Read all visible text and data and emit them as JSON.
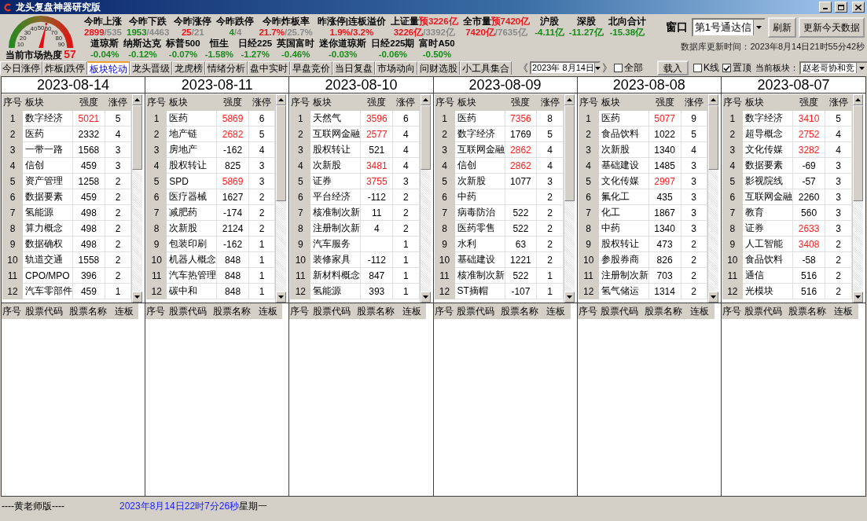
{
  "window": {
    "title": "龙头复盘神器研究版"
  },
  "gauge": {
    "ticks": [
      "10",
      "20",
      "30",
      "40",
      "50",
      "60",
      "70",
      "80",
      "90"
    ],
    "level": 0.57,
    "label": "当前市场热度",
    "value": "57"
  },
  "stats": [
    {
      "label": "今昨上涨",
      "parts": [
        {
          "text": "2899",
          "color": "#e8161b"
        },
        {
          "text": "/535",
          "color": "#8a8a8a"
        }
      ]
    },
    {
      "label": "今昨下跌",
      "parts": [
        {
          "text": "1953",
          "color": "#1a8a1a"
        },
        {
          "text": "/4463",
          "color": "#8a8a8a"
        }
      ]
    },
    {
      "label": "今昨涨停",
      "parts": [
        {
          "text": "25",
          "color": "#e8161b"
        },
        {
          "text": "/21",
          "color": "#8a8a8a"
        }
      ]
    },
    {
      "label": "今昨跌停",
      "parts": [
        {
          "text": "4",
          "color": "#1a8a1a"
        },
        {
          "text": "/4",
          "color": "#8a8a8a"
        }
      ]
    },
    {
      "label": "今昨炸板率",
      "parts": [
        {
          "text": "21.7%",
          "color": "#e8161b"
        },
        {
          "text": "/25.7%",
          "color": "#8a8a8a"
        }
      ]
    },
    {
      "label": "昨涨停|连板溢价",
      "parts": [
        {
          "text": "1.9%",
          "color": "#e8161b"
        },
        {
          "text": "/3.2%",
          "color": "#e8161b"
        }
      ]
    },
    {
      "label": "上证量",
      "forecast": "预3226亿",
      "parts": [
        {
          "text": "3226亿",
          "color": "#e8161b"
        },
        {
          "text": "/3392亿",
          "color": "#8a8a8a"
        }
      ]
    },
    {
      "label": "全市量",
      "forecast": "预7420亿",
      "parts": [
        {
          "text": "7420亿",
          "color": "#e8161b"
        },
        {
          "text": "/7635亿",
          "color": "#8a8a8a"
        }
      ]
    },
    {
      "label": "沪股",
      "parts": [
        {
          "text": "-4.11亿",
          "color": "#1a8a1a"
        }
      ]
    },
    {
      "label": "深股",
      "parts": [
        {
          "text": "-11.27亿",
          "color": "#1a8a1a"
        }
      ]
    },
    {
      "label": "北向合计",
      "parts": [
        {
          "text": "-15.38亿",
          "color": "#1a8a1a"
        }
      ]
    }
  ],
  "indices": [
    {
      "label": "道琼斯",
      "value": "-0.04%",
      "color": "#1a8a1a"
    },
    {
      "label": "纳斯达克",
      "value": "-0.12%",
      "color": "#1a8a1a"
    },
    {
      "label": "标普500",
      "value": "-0.07%",
      "color": "#1a8a1a"
    },
    {
      "label": "恒生",
      "value": "-1.58%",
      "color": "#1a8a1a"
    },
    {
      "label": "日经225",
      "value": "-1.27%",
      "color": "#1a8a1a"
    },
    {
      "label": "英国富时",
      "value": "-0.46%",
      "color": "#1a8a1a"
    },
    {
      "label": "迷你道琼斯",
      "value": "-0.03%",
      "color": "#1a8a1a"
    },
    {
      "label": "日经225期",
      "value": "-0.06%",
      "color": "#1a8a1a"
    },
    {
      "label": "富时A50",
      "value": "-0.50%",
      "color": "#1a8a1a"
    }
  ],
  "window_picker": {
    "label": "窗口",
    "value": "第1号通达信"
  },
  "buttons": [
    "刷新",
    "更新今天数据"
  ],
  "db_update": "数据库更新时间：2023年8月14日21时55分42秒",
  "tabs": [
    {
      "label": "今日涨停",
      "selected": false
    },
    {
      "label": "炸板|跌停",
      "selected": false
    },
    {
      "label": "板块轮动",
      "selected": true
    },
    {
      "label": "龙头晋级",
      "selected": false
    },
    {
      "label": "龙虎榜",
      "selected": false
    },
    {
      "label": "情绪分析",
      "selected": false
    },
    {
      "label": "盘中实时",
      "selected": false
    },
    {
      "label": "早盘竞价",
      "selected": false
    },
    {
      "label": "当日复盘",
      "selected": false
    },
    {
      "label": "市场动向",
      "selected": false
    },
    {
      "label": "问财选股",
      "selected": false
    },
    {
      "label": "小工具集合",
      "selected": false
    }
  ],
  "date_nav": {
    "prev": "《",
    "date": "2023年 8月14日",
    "next": "》",
    "all": {
      "label": "全部",
      "checked": false
    }
  },
  "load_button": "载入",
  "options": [
    {
      "label": "K线",
      "checked": false
    },
    {
      "label": "置顶",
      "checked": true
    }
  ],
  "current_sector": {
    "label": "当前板块：",
    "value": "赵老哥协和竞"
  },
  "days": [
    {
      "date": "2023-08-14",
      "columns": [
        "序号",
        "板块",
        "强度",
        "涨停"
      ],
      "stock_columns": [
        "序号",
        "股票代码",
        "股票名称",
        "连板"
      ],
      "rows": [
        {
          "no": "1",
          "sector": "数字经济",
          "strength": "5021",
          "hot": true,
          "limit_ups": "5"
        },
        {
          "no": "2",
          "sector": "医药",
          "strength": "2332",
          "hot": false,
          "limit_ups": "4"
        },
        {
          "no": "3",
          "sector": "一带一路",
          "strength": "1568",
          "hot": false,
          "limit_ups": "3"
        },
        {
          "no": "4",
          "sector": "信创",
          "strength": "459",
          "hot": false,
          "limit_ups": "3"
        },
        {
          "no": "5",
          "sector": "资产管理",
          "strength": "1258",
          "hot": false,
          "limit_ups": "2"
        },
        {
          "no": "6",
          "sector": "数据要素",
          "strength": "459",
          "hot": false,
          "limit_ups": "2"
        },
        {
          "no": "7",
          "sector": "氢能源",
          "strength": "498",
          "hot": false,
          "limit_ups": "2"
        },
        {
          "no": "8",
          "sector": "算力概念",
          "strength": "498",
          "hot": false,
          "limit_ups": "2"
        },
        {
          "no": "9",
          "sector": "数据确权",
          "strength": "498",
          "hot": false,
          "limit_ups": "2"
        },
        {
          "no": "10",
          "sector": "轨道交通",
          "strength": "1558",
          "hot": false,
          "limit_ups": "2"
        },
        {
          "no": "11",
          "sector": "CPO/MPO",
          "strength": "396",
          "hot": false,
          "limit_ups": "2"
        },
        {
          "no": "12",
          "sector": "汽车零部件",
          "strength": "459",
          "hot": false,
          "limit_ups": "1"
        }
      ]
    },
    {
      "date": "2023-08-11",
      "columns": [
        "序号",
        "板块",
        "强度",
        "涨停"
      ],
      "stock_columns": [
        "序号",
        "股票代码",
        "股票名称",
        "连板"
      ],
      "rows": [
        {
          "no": "1",
          "sector": "医药",
          "strength": "5869",
          "hot": true,
          "limit_ups": "6"
        },
        {
          "no": "2",
          "sector": "地产链",
          "strength": "2682",
          "hot": true,
          "limit_ups": "5"
        },
        {
          "no": "3",
          "sector": "房地产",
          "strength": "-162",
          "hot": false,
          "limit_ups": "4"
        },
        {
          "no": "4",
          "sector": "股权转让",
          "strength": "825",
          "hot": false,
          "limit_ups": "3"
        },
        {
          "no": "5",
          "sector": "SPD",
          "strength": "5869",
          "hot": true,
          "limit_ups": "3"
        },
        {
          "no": "6",
          "sector": "医疗器械",
          "strength": "1627",
          "hot": false,
          "limit_ups": "2"
        },
        {
          "no": "7",
          "sector": "减肥药",
          "strength": "-174",
          "hot": false,
          "limit_ups": "2"
        },
        {
          "no": "8",
          "sector": "次新股",
          "strength": "2124",
          "hot": false,
          "limit_ups": "2"
        },
        {
          "no": "9",
          "sector": "包装印刷",
          "strength": "-162",
          "hot": false,
          "limit_ups": "1"
        },
        {
          "no": "10",
          "sector": "机器人概念",
          "strength": "848",
          "hot": false,
          "limit_ups": "1"
        },
        {
          "no": "11",
          "sector": "汽车热管理",
          "strength": "848",
          "hot": false,
          "limit_ups": "1"
        },
        {
          "no": "12",
          "sector": "碳中和",
          "strength": "848",
          "hot": false,
          "limit_ups": "1"
        }
      ]
    },
    {
      "date": "2023-08-10",
      "columns": [
        "序号",
        "板块",
        "强度",
        "涨停"
      ],
      "stock_columns": [
        "序号",
        "股票代码",
        "股票名称",
        "连板"
      ],
      "rows": [
        {
          "no": "1",
          "sector": "天然气",
          "strength": "3596",
          "hot": true,
          "limit_ups": "6"
        },
        {
          "no": "2",
          "sector": "互联网金融",
          "strength": "2577",
          "hot": true,
          "limit_ups": "4"
        },
        {
          "no": "3",
          "sector": "股权转让",
          "strength": "521",
          "hot": false,
          "limit_ups": "4"
        },
        {
          "no": "4",
          "sector": "次新股",
          "strength": "3481",
          "hot": true,
          "limit_ups": "4"
        },
        {
          "no": "5",
          "sector": "证券",
          "strength": "3755",
          "hot": true,
          "limit_ups": "3"
        },
        {
          "no": "6",
          "sector": "平台经济",
          "strength": "-112",
          "hot": false,
          "limit_ups": "2"
        },
        {
          "no": "7",
          "sector": "核准制次新",
          "strength": "11",
          "hot": false,
          "limit_ups": "2"
        },
        {
          "no": "8",
          "sector": "注册制次新",
          "strength": "4",
          "hot": false,
          "limit_ups": "2"
        },
        {
          "no": "9",
          "sector": "汽车服务",
          "limit_ups": "1"
        },
        {
          "no": "10",
          "sector": "装修家具",
          "strength": "-112",
          "hot": false,
          "limit_ups": "1"
        },
        {
          "no": "11",
          "sector": "新材料概念",
          "strength": "847",
          "hot": false,
          "limit_ups": "1"
        },
        {
          "no": "12",
          "sector": "氢能源",
          "strength": "393",
          "hot": false,
          "limit_ups": "1"
        }
      ]
    },
    {
      "date": "2023-08-09",
      "columns": [
        "序号",
        "板块",
        "强度",
        "涨停"
      ],
      "stock_columns": [
        "序号",
        "股票代码",
        "股票名称",
        "连板"
      ],
      "rows": [
        {
          "no": "1",
          "sector": "医药",
          "strength": "7356",
          "hot": true,
          "limit_ups": "8"
        },
        {
          "no": "2",
          "sector": "数字经济",
          "strength": "1769",
          "hot": false,
          "limit_ups": "5"
        },
        {
          "no": "3",
          "sector": "互联网金融",
          "strength": "2862",
          "hot": true,
          "limit_ups": "4"
        },
        {
          "no": "4",
          "sector": "信创",
          "strength": "2862",
          "hot": true,
          "limit_ups": "4"
        },
        {
          "no": "5",
          "sector": "次新股",
          "strength": "1077",
          "hot": false,
          "limit_ups": "3"
        },
        {
          "no": "6",
          "sector": "中药",
          "limit_ups": "2"
        },
        {
          "no": "7",
          "sector": "病毒防治",
          "strength": "522",
          "hot": false,
          "limit_ups": "2"
        },
        {
          "no": "8",
          "sector": "医药零售",
          "strength": "522",
          "hot": false,
          "limit_ups": "2"
        },
        {
          "no": "9",
          "sector": "水利",
          "strength": "63",
          "hot": false,
          "limit_ups": "2"
        },
        {
          "no": "10",
          "sector": "基础建设",
          "strength": "1221",
          "hot": false,
          "limit_ups": "2"
        },
        {
          "no": "11",
          "sector": "核准制次新",
          "strength": "522",
          "hot": false,
          "limit_ups": "1"
        },
        {
          "no": "12",
          "sector": "ST摘帽",
          "strength": "-107",
          "hot": false,
          "limit_ups": "1"
        }
      ]
    },
    {
      "date": "2023-08-08",
      "columns": [
        "序号",
        "板块",
        "强度",
        "涨停"
      ],
      "stock_columns": [
        "序号",
        "股票代码",
        "股票名称",
        "连板"
      ],
      "rows": [
        {
          "no": "1",
          "sector": "医药",
          "strength": "5077",
          "hot": true,
          "limit_ups": "9"
        },
        {
          "no": "2",
          "sector": "食品饮料",
          "strength": "1022",
          "hot": false,
          "limit_ups": "5"
        },
        {
          "no": "3",
          "sector": "次新股",
          "strength": "1340",
          "hot": false,
          "limit_ups": "4"
        },
        {
          "no": "4",
          "sector": "基础建设",
          "strength": "1485",
          "hot": false,
          "limit_ups": "3"
        },
        {
          "no": "5",
          "sector": "文化传媒",
          "strength": "2997",
          "hot": true,
          "limit_ups": "3"
        },
        {
          "no": "6",
          "sector": "氟化工",
          "strength": "435",
          "hot": false,
          "limit_ups": "3"
        },
        {
          "no": "7",
          "sector": "化工",
          "strength": "1867",
          "hot": false,
          "limit_ups": "3"
        },
        {
          "no": "8",
          "sector": "中药",
          "strength": "1340",
          "hot": false,
          "limit_ups": "3"
        },
        {
          "no": "9",
          "sector": "股权转让",
          "strength": "473",
          "hot": false,
          "limit_ups": "2"
        },
        {
          "no": "10",
          "sector": "参股券商",
          "strength": "826",
          "hot": false,
          "limit_ups": "2"
        },
        {
          "no": "11",
          "sector": "注册制次新",
          "strength": "703",
          "hot": false,
          "limit_ups": "2"
        },
        {
          "no": "12",
          "sector": "氢气储运",
          "strength": "1314",
          "hot": false,
          "limit_ups": "2"
        }
      ]
    },
    {
      "date": "2023-08-07",
      "columns": [
        "序号",
        "板块",
        "强度",
        "涨停"
      ],
      "stock_columns": [
        "序号",
        "股票代码",
        "股票名称",
        "连板"
      ],
      "rows": [
        {
          "no": "1",
          "sector": "数字经济",
          "strength": "3410",
          "hot": true,
          "limit_ups": "5"
        },
        {
          "no": "2",
          "sector": "超导概念",
          "strength": "2752",
          "hot": true,
          "limit_ups": "4"
        },
        {
          "no": "3",
          "sector": "文化传媒",
          "strength": "3282",
          "hot": true,
          "limit_ups": "4"
        },
        {
          "no": "4",
          "sector": "数据要素",
          "strength": "-69",
          "hot": false,
          "limit_ups": "3"
        },
        {
          "no": "5",
          "sector": "影视院线",
          "strength": "-57",
          "hot": false,
          "limit_ups": "3"
        },
        {
          "no": "6",
          "sector": "互联网金融",
          "strength": "2260",
          "hot": false,
          "limit_ups": "3"
        },
        {
          "no": "7",
          "sector": "教育",
          "strength": "560",
          "hot": false,
          "limit_ups": "3"
        },
        {
          "no": "8",
          "sector": "证券",
          "strength": "2633",
          "hot": true,
          "limit_ups": "3"
        },
        {
          "no": "9",
          "sector": "人工智能",
          "strength": "3408",
          "hot": true,
          "limit_ups": "2"
        },
        {
          "no": "10",
          "sector": "食品饮料",
          "strength": "-58",
          "hot": false,
          "limit_ups": "2"
        },
        {
          "no": "11",
          "sector": "通信",
          "strength": "516",
          "hot": false,
          "limit_ups": "2"
        },
        {
          "no": "12",
          "sector": "光模块",
          "strength": "516",
          "hot": false,
          "limit_ups": "2"
        }
      ]
    }
  ],
  "footer": {
    "edition": "----黄老师版----",
    "time": "2023年8月14日22时7分26秒",
    "weekday": "星期一"
  }
}
